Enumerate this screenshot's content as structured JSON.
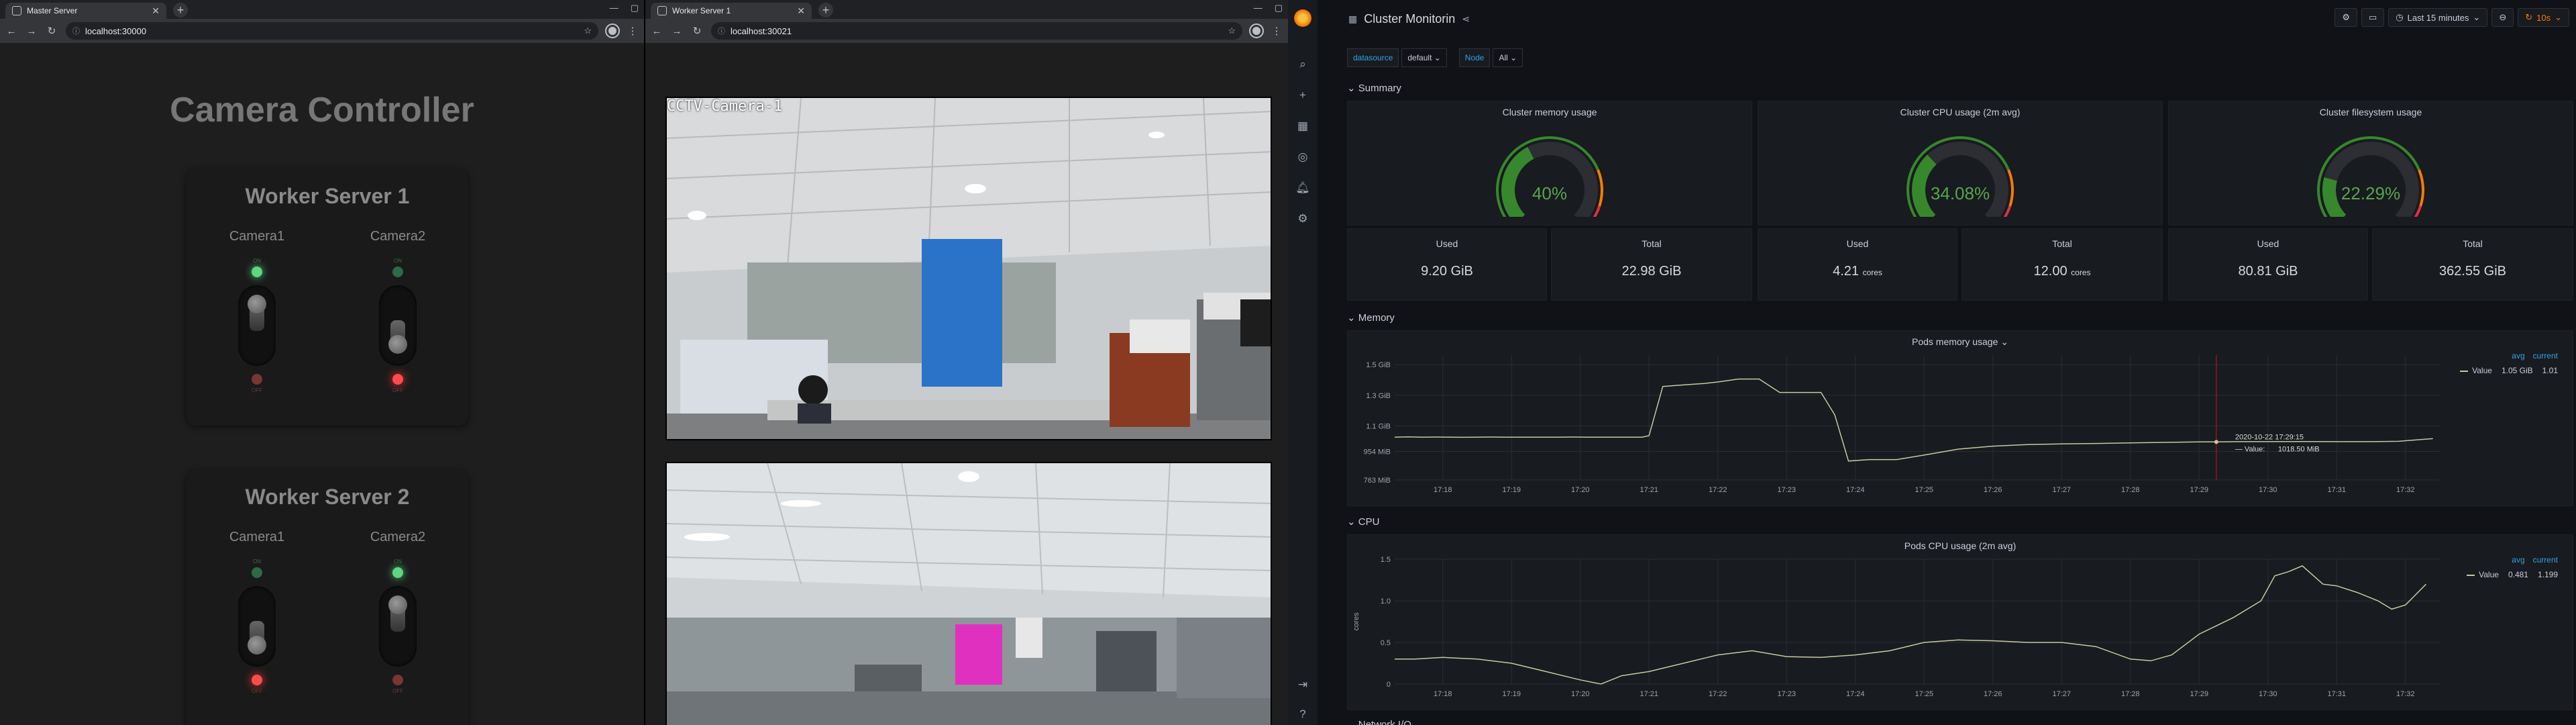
{
  "master": {
    "tab_title": "Master Server",
    "url": "localhost:30000",
    "heading": "Camera Controller",
    "workers": [
      {
        "title": "Worker Server 1",
        "cameras": [
          {
            "label": "Camera1",
            "state": "on",
            "on_text": "ON",
            "off_text": "OFF"
          },
          {
            "label": "Camera2",
            "state": "off",
            "on_text": "ON",
            "off_text": "OFF"
          }
        ]
      },
      {
        "title": "Worker Server 2",
        "cameras": [
          {
            "label": "Camera1",
            "state": "off",
            "on_text": "ON",
            "off_text": "OFF"
          },
          {
            "label": "Camera2",
            "state": "on",
            "on_text": "ON",
            "off_text": "OFF"
          }
        ]
      }
    ]
  },
  "worker": {
    "tab_title": "Worker Server 1",
    "url": "localhost:30021",
    "feed1_label": "CCTV-Camera-1"
  },
  "grafana": {
    "title": "Cluster Monitorin",
    "time_range": "Last 15 minutes",
    "refresh": "10s",
    "vars": [
      {
        "label": "datasource",
        "value": "default"
      },
      {
        "label": "Node",
        "value": "All"
      }
    ],
    "rows": {
      "summary": "Summary",
      "memory": "Memory",
      "cpu": "CPU",
      "network": "Network I/O"
    },
    "gauges": [
      {
        "title": "Cluster memory usage",
        "value": "40%",
        "percent": 40
      },
      {
        "title": "Cluster CPU usage (2m avg)",
        "value": "34.08%",
        "percent": 34.08
      },
      {
        "title": "Cluster filesystem usage",
        "value": "22.29%",
        "percent": 22.29
      }
    ],
    "stats": [
      {
        "label": "Used",
        "value": "9.20 GiB",
        "unit": ""
      },
      {
        "label": "Total",
        "value": "22.98 GiB",
        "unit": ""
      },
      {
        "label": "Used",
        "value": "4.21",
        "unit": "cores"
      },
      {
        "label": "Total",
        "value": "12.00",
        "unit": "cores"
      },
      {
        "label": "Used",
        "value": "80.81 GiB",
        "unit": ""
      },
      {
        "label": "Total",
        "value": "362.55 GiB",
        "unit": ""
      }
    ],
    "memory_panel": {
      "title": "Pods memory usage",
      "legend_avg": "avg",
      "legend_current": "current",
      "series_name": "Value",
      "avg": "1.05 GiB",
      "current": "1.01",
      "tooltip_time": "2020-10-22 17:29:15",
      "tooltip_label": "Value:",
      "tooltip_value": "1018.50 MiB"
    },
    "cpu_panel": {
      "title": "Pods CPU usage (2m avg)",
      "legend_avg": "avg",
      "legend_current": "current",
      "series_name": "Value",
      "avg": "0.481",
      "current": "1.199"
    },
    "colors": {
      "green": "#37872d",
      "orange": "#ff7a00",
      "blue": "#33a2e5",
      "series": "#c8c8a0"
    }
  },
  "chart_data": [
    {
      "type": "line",
      "title": "Pods memory usage",
      "x_ticks": [
        "17:18",
        "17:19",
        "17:20",
        "17:21",
        "17:22",
        "17:23",
        "17:24",
        "17:25",
        "17:26",
        "17:27",
        "17:28",
        "17:29",
        "17:30",
        "17:31",
        "17:32"
      ],
      "y_ticks": [
        "763 MiB",
        "954 MiB",
        "1.1 GiB",
        "1.3 GiB",
        "1.5 GiB"
      ],
      "ylim": [
        763,
        1600
      ],
      "series": [
        {
          "name": "Value",
          "x": [
            17.3,
            17.5,
            17.7,
            17.9,
            18.1,
            18.3,
            18.5,
            18.7,
            18.9,
            19.1,
            19.3,
            19.5,
            19.7,
            19.9,
            20.1,
            20.3,
            20.5,
            20.7,
            20.9,
            21.0,
            21.2,
            21.5,
            21.8,
            22.0,
            22.3,
            22.6,
            22.9,
            23.2,
            23.5,
            23.7,
            23.9,
            24.2,
            24.6,
            25.0,
            25.5,
            26.0,
            26.5,
            27.0,
            27.5,
            28.0,
            28.5,
            29.0,
            29.3,
            29.6,
            30.0,
            30.5,
            31.0,
            31.5,
            31.9,
            32.1,
            32.4
          ],
          "y": [
            1050,
            1052,
            1050,
            1051,
            1050,
            1049,
            1050,
            1051,
            1050,
            1050,
            1050,
            1050,
            1050,
            1051,
            1050,
            1050,
            1050,
            1050,
            1050,
            1060,
            1390,
            1400,
            1410,
            1420,
            1440,
            1440,
            1350,
            1350,
            1350,
            1200,
            890,
            900,
            900,
            930,
            970,
            990,
            1000,
            1005,
            1008,
            1012,
            1015,
            1018,
            1018,
            1020,
            1020,
            1021,
            1020,
            1020,
            1022,
            1030,
            1040
          ]
        }
      ]
    },
    {
      "type": "line",
      "title": "Pods CPU usage (2m avg)",
      "ylabel": "cores",
      "x_ticks": [
        "17:18",
        "17:19",
        "17:20",
        "17:21",
        "17:22",
        "17:23",
        "17:24",
        "17:25",
        "17:26",
        "17:27",
        "17:28",
        "17:29",
        "17:30",
        "17:31",
        "17:32"
      ],
      "y_ticks": [
        "0",
        "0.5",
        "1.0",
        "1.5"
      ],
      "ylim": [
        0,
        1.5
      ],
      "series": [
        {
          "name": "Value",
          "x": [
            17.3,
            17.6,
            18.0,
            18.5,
            19.0,
            19.5,
            20.0,
            20.3,
            20.6,
            21.0,
            21.5,
            22.0,
            22.5,
            23.0,
            23.5,
            24.0,
            24.5,
            25.0,
            25.5,
            26.0,
            26.5,
            27.0,
            27.5,
            28.0,
            28.3,
            28.6,
            29.0,
            29.5,
            29.9,
            30.1,
            30.3,
            30.5,
            30.8,
            31.0,
            31.3,
            31.6,
            31.8,
            32.0,
            32.3
          ],
          "y": [
            0.3,
            0.3,
            0.32,
            0.3,
            0.25,
            0.15,
            0.05,
            0.0,
            0.1,
            0.15,
            0.25,
            0.35,
            0.4,
            0.33,
            0.32,
            0.35,
            0.4,
            0.5,
            0.53,
            0.52,
            0.5,
            0.5,
            0.45,
            0.3,
            0.28,
            0.35,
            0.6,
            0.8,
            1.0,
            1.3,
            1.35,
            1.42,
            1.2,
            1.18,
            1.1,
            1.0,
            0.9,
            0.95,
            1.2
          ]
        }
      ]
    }
  ]
}
